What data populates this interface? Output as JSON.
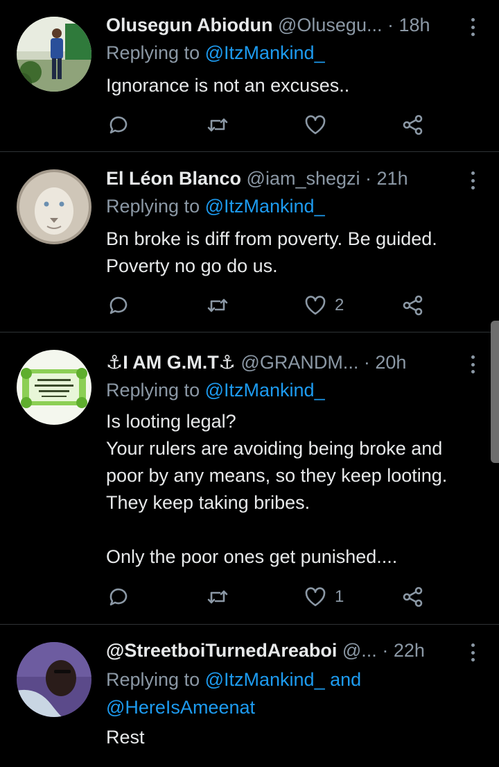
{
  "tweets": [
    {
      "name": "Olusegun Abiodun",
      "handle": "@Olusegu...",
      "time": "· 18h",
      "replying_label": "Replying to",
      "replying_to": "@ItzMankind_",
      "replying_extra": "",
      "replying_to2": "",
      "body": [
        "Ignorance is not an excuses.."
      ],
      "likes": "",
      "avatar_icon": "profile-photo-man-standing"
    },
    {
      "name": "El Léon Blanco",
      "handle": "@iam_shegzi",
      "time": "· 21h",
      "replying_label": "Replying to",
      "replying_to": "@ItzMankind_",
      "replying_extra": "",
      "replying_to2": "",
      "body": [
        "Bn broke is diff from poverty. Be guided.",
        "Poverty no go do us."
      ],
      "likes": "2",
      "avatar_icon": "white-lion"
    },
    {
      "name": "⚓I AM G.M.T⚓",
      "handle": "@GRANDM...",
      "time": "· 20h",
      "replying_label": "Replying to",
      "replying_to": "@ItzMankind_",
      "replying_extra": "",
      "replying_to2": "",
      "body": [
        "Is looting legal?",
        "Your rulers are avoiding being broke and",
        "poor by any means, so they keep looting.",
        "They keep taking bribes.",
        "",
        "Only the poor ones get punished...."
      ],
      "likes": "1",
      "avatar_icon": "leafy-quote-card"
    },
    {
      "name": "@StreetboiTurnedAreaboi",
      "handle": "@...",
      "time": "· 22h",
      "replying_label": "Replying to",
      "replying_to": "@ItzMankind_",
      "replying_extra": " and",
      "replying_to2": "@HereIsAmeenat",
      "body": [
        "Rest"
      ],
      "likes": "",
      "avatar_icon": "selfie-purple"
    }
  ],
  "colors": {
    "background": "#000000",
    "link": "#1d9bf0",
    "muted": "#8b98a5",
    "text": "#e7e9ea",
    "divider": "#2f3336"
  },
  "icons": [
    "reply-icon",
    "retweet-icon",
    "like-icon",
    "share-icon",
    "more-icon"
  ]
}
